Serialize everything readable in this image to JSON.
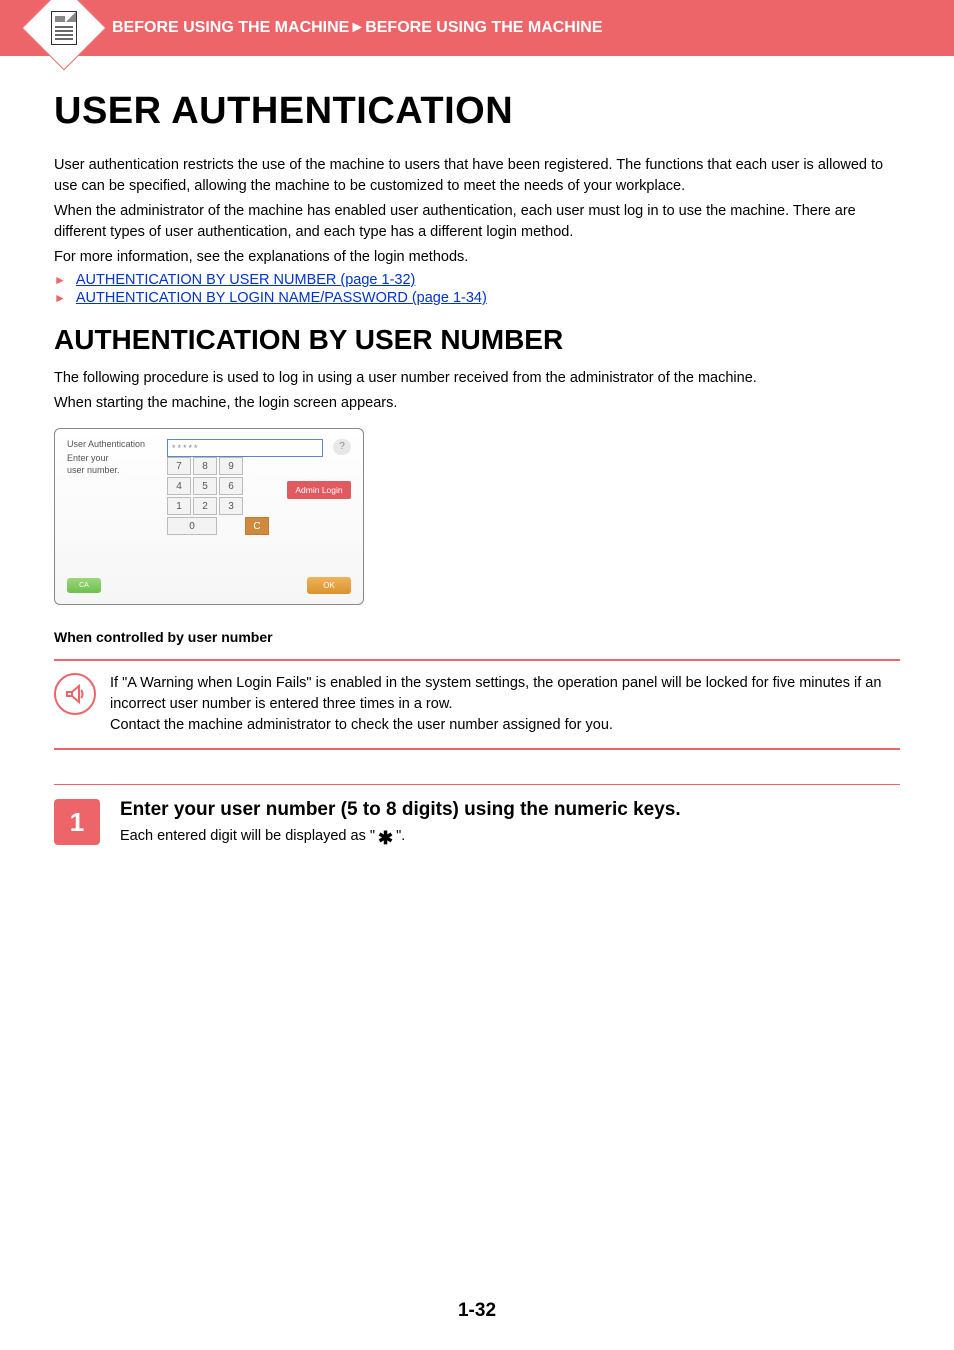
{
  "header": {
    "breadcrumb_left": "BEFORE USING THE MACHINE",
    "breadcrumb_sep": "►",
    "breadcrumb_right": "BEFORE USING THE MACHINE"
  },
  "h1": "USER AUTHENTICATION",
  "intro": [
    "User authentication restricts the use of the machine to users that have been registered. The functions that each user is allowed to use can be specified, allowing the machine to be customized to meet the needs of your workplace.",
    "When the administrator of the machine has enabled user authentication, each user must log in to use the machine. There are different types of user authentication, and each type has a different login method.",
    "For more information, see the explanations of the login methods."
  ],
  "links": [
    "AUTHENTICATION BY USER NUMBER (page 1-32)",
    "AUTHENTICATION BY LOGIN NAME/PASSWORD (page 1-34)"
  ],
  "h2": "AUTHENTICATION BY USER NUMBER",
  "sub_intro": [
    "The following procedure is used to log in using a user number received from the administrator of the machine.",
    "When starting the machine, the login screen appears."
  ],
  "login_panel": {
    "title": "User Authentication",
    "instruction_l1": "Enter your",
    "instruction_l2": "user number.",
    "mask": "*****",
    "help": "?",
    "keys": [
      "7",
      "8",
      "9",
      "4",
      "5",
      "6",
      "1",
      "2",
      "3",
      "0",
      "C"
    ],
    "admin_login": "Admin Login",
    "ca": "CA",
    "ok": "OK"
  },
  "caption": "When controlled by user number",
  "note": [
    "If \"A Warning when Login Fails\" is enabled in the system settings, the operation panel will be locked for five minutes if an incorrect user number is entered three times in a row.",
    "Contact the machine administrator to check the user number assigned for you."
  ],
  "step": {
    "num": "1",
    "title": "Enter your user number (5 to 8 digits) using the numeric keys.",
    "sub_before": "Each entered digit will be displayed as \" ",
    "sub_after": " \"."
  },
  "page_number": "1-32"
}
